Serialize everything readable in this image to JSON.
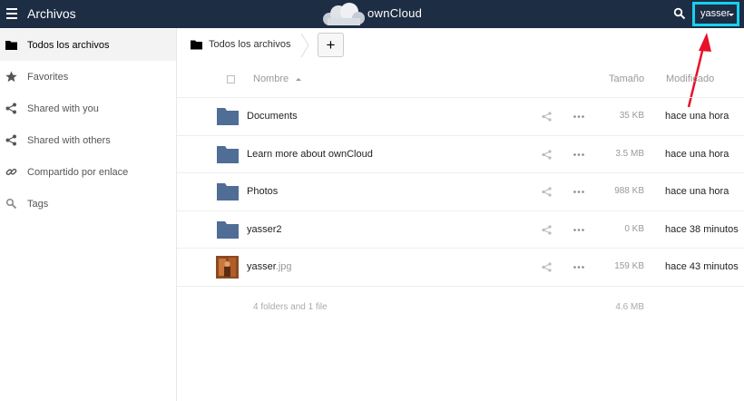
{
  "header": {
    "app_title": "Archivos",
    "logo_text": "ownCloud",
    "user_name": "yasser",
    "colors": {
      "header_bg": "#1d2d44",
      "highlight": "#16d0ef",
      "arrow": "#e8102a"
    }
  },
  "sidebar": {
    "items": [
      {
        "label": "Todos los archivos",
        "icon": "folder-icon",
        "active": true
      },
      {
        "label": "Favorites",
        "icon": "star-icon"
      },
      {
        "label": "Shared with you",
        "icon": "share-icon"
      },
      {
        "label": "Shared with others",
        "icon": "share-icon"
      },
      {
        "label": "Compartido por enlace",
        "icon": "link-icon"
      },
      {
        "label": "Tags",
        "icon": "tag-icon"
      }
    ]
  },
  "controls": {
    "breadcrumb": "Todos los archivos",
    "new_button": "+"
  },
  "table": {
    "headers": {
      "name": "Nombre",
      "size": "Tamaño",
      "modified": "Modificado"
    },
    "rows": [
      {
        "name": "Documents",
        "ext": "",
        "type": "folder",
        "size": "35 KB",
        "modified": "hace una hora"
      },
      {
        "name": "Learn more about ownCloud",
        "ext": "",
        "type": "folder",
        "size": "3.5 MB",
        "modified": "hace una hora"
      },
      {
        "name": "Photos",
        "ext": "",
        "type": "folder",
        "size": "988 KB",
        "modified": "hace una hora"
      },
      {
        "name": "yasser2",
        "ext": "",
        "type": "folder",
        "size": "0 KB",
        "modified": "hace 38 minutos"
      },
      {
        "name": "yasser",
        "ext": ".jpg",
        "type": "image",
        "size": "159 KB",
        "modified": "hace 43 minutos"
      }
    ],
    "summary": {
      "label": "4 folders and 1 file",
      "size": "4.6 MB"
    }
  }
}
